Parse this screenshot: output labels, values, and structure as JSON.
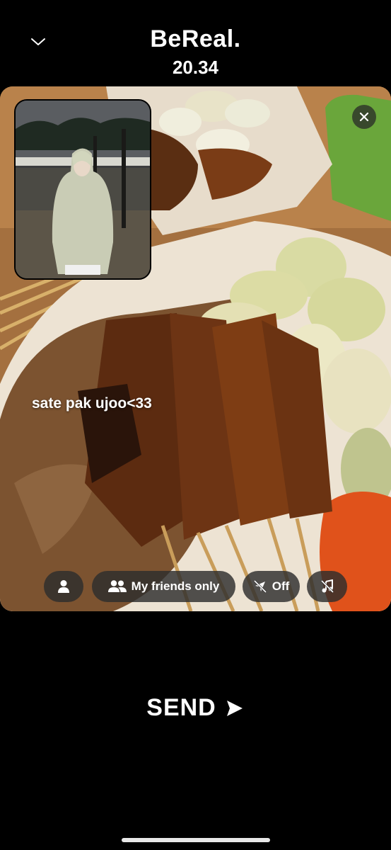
{
  "header": {
    "title": "BeReal.",
    "time": "20.34",
    "collapse_icon": "chevron-down-icon"
  },
  "post": {
    "caption": "sate pak ujoo<33",
    "close_icon": "close-icon"
  },
  "options": {
    "tag_icon": "person-icon",
    "audience_label": "My friends only",
    "audience_icon": "friends-icon",
    "location_label": "Off",
    "location_icon": "location-off-icon",
    "music_icon": "music-off-icon"
  },
  "send": {
    "label": "SEND",
    "icon": "send-arrow-icon"
  }
}
